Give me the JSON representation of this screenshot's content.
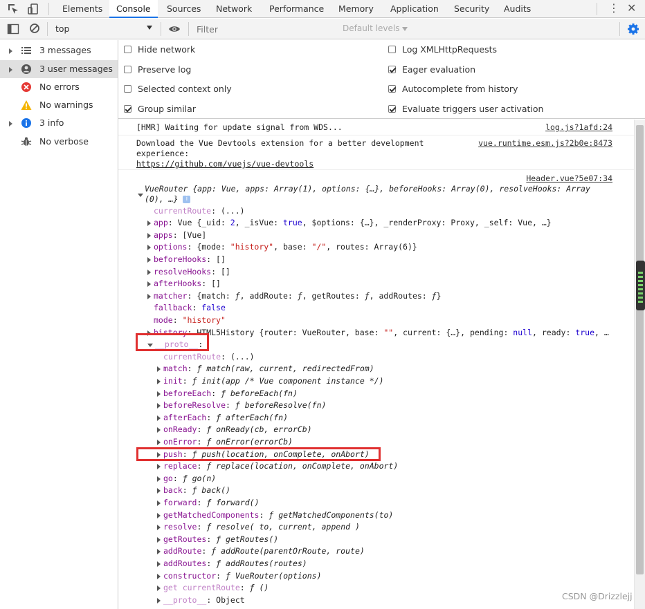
{
  "tabs": [
    {
      "label": "Elements"
    },
    {
      "label": "Console",
      "active": true
    },
    {
      "label": "Sources"
    },
    {
      "label": "Network"
    },
    {
      "label": "Performance"
    },
    {
      "label": "Memory"
    },
    {
      "label": "Application"
    },
    {
      "label": "Security"
    },
    {
      "label": "Audits"
    }
  ],
  "toolbar": {
    "context": "top",
    "filter_placeholder": "Filter",
    "levels": "Default levels"
  },
  "sidebar": {
    "items": [
      {
        "label": "3 messages",
        "icon": "list-icon"
      },
      {
        "label": "3 user messages",
        "icon": "user-icon"
      },
      {
        "label": "No errors",
        "icon": "error-icon"
      },
      {
        "label": "No warnings",
        "icon": "warning-icon"
      },
      {
        "label": "3 info",
        "icon": "info-icon"
      },
      {
        "label": "No verbose",
        "icon": "bug-icon"
      }
    ]
  },
  "settings": {
    "hide_network": "Hide network",
    "preserve_log": "Preserve log",
    "selected_context": "Selected context only",
    "group_similar": "Group similar",
    "log_xhr": "Log XMLHttpRequests",
    "eager_eval": "Eager evaluation",
    "autocomplete": "Autocomplete from history",
    "evaluate_triggers": "Evaluate triggers user activation"
  },
  "console": {
    "msg1": {
      "text": "[HMR] Waiting for update signal from WDS...",
      "source": "log.js?1afd:24"
    },
    "msg2": {
      "line1": "Download the Vue Devtools extension for a better development",
      "line2": "experience:",
      "link": "https://github.com/vuejs/vue-devtools",
      "source": "vue.runtime.esm.js?2b0e:8473"
    },
    "msg3_source": "Header.vue?5e07:34"
  },
  "watermark": "CSDN @Drizzlejj",
  "colors": {
    "accent": "#1a73e8",
    "highlight_box": "#e03030"
  }
}
